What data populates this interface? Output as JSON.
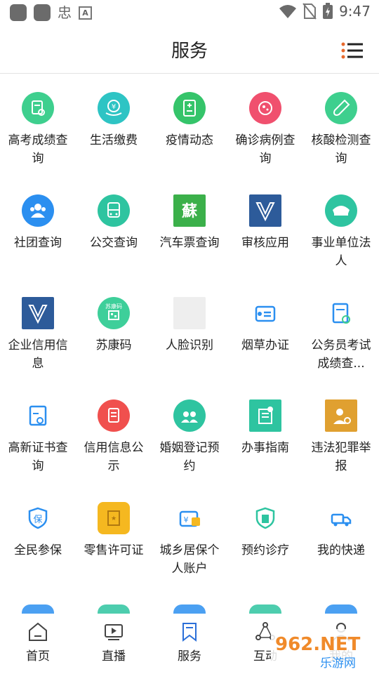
{
  "status_bar": {
    "time": "9:47",
    "glyph": "忠",
    "a_label": "A"
  },
  "header": {
    "title": "服务"
  },
  "services": [
    {
      "label": "高考成绩查询",
      "icon": "exam-score-icon",
      "color": "#3ecf8e"
    },
    {
      "label": "生活缴费",
      "icon": "payment-icon",
      "color": "#2ec4c4"
    },
    {
      "label": "疫情动态",
      "icon": "epidemic-icon",
      "color": "#35c46a"
    },
    {
      "label": "确诊病例查询",
      "icon": "virus-icon",
      "color": "#f0506e"
    },
    {
      "label": "核酸检测查询",
      "icon": "test-tube-icon",
      "color": "#3ecf8e"
    },
    {
      "label": "社团查询",
      "icon": "group-icon",
      "color": "#2b8ff0"
    },
    {
      "label": "公交查询",
      "icon": "bus-icon",
      "color": "#2ec4a0"
    },
    {
      "label": "汽车票查询",
      "icon": "su-calligraphy-icon",
      "color": "#3bb04a"
    },
    {
      "label": "审核应用",
      "icon": "v-logo-icon",
      "color": "#2d5b9a"
    },
    {
      "label": "事业单位法人",
      "icon": "official-cap-icon",
      "color": "#2ec4a0"
    },
    {
      "label": "企业信用信息",
      "icon": "v-logo-icon",
      "color": "#2d5b9a"
    },
    {
      "label": "苏康码",
      "icon": "health-code-icon",
      "color": "#3ecf9a"
    },
    {
      "label": "人脸识别",
      "icon": "face-placeholder-icon",
      "color": "#eeeeee"
    },
    {
      "label": "烟草办证",
      "icon": "id-card-icon",
      "color": "#2b8ff0"
    },
    {
      "label": "公务员考试成绩查...",
      "icon": "clipboard-search-icon",
      "color": "#2b8ff0"
    },
    {
      "label": "高新证书查询",
      "icon": "certificate-icon",
      "color": "#2b8ff0"
    },
    {
      "label": "信用信息公示",
      "icon": "document-icon",
      "color": "#f0504e"
    },
    {
      "label": "婚姻登记预约",
      "icon": "couple-icon",
      "color": "#2ec4a0"
    },
    {
      "label": "办事指南",
      "icon": "guide-icon",
      "color": "#2ec4a0"
    },
    {
      "label": "违法犯罪举报",
      "icon": "police-icon",
      "color": "#e0a030"
    },
    {
      "label": "全民参保",
      "icon": "insurance-shield-icon",
      "color": "#2b8ff0"
    },
    {
      "label": "零售许可证",
      "icon": "license-icon",
      "color": "#f5b820"
    },
    {
      "label": "城乡居保个人账户",
      "icon": "wallet-icon",
      "color": "#2b8ff0"
    },
    {
      "label": "预约诊疗",
      "icon": "hospital-shield-icon",
      "color": "#2ec4a0"
    },
    {
      "label": "我的快递",
      "icon": "delivery-truck-icon",
      "color": "#2b8ff0"
    }
  ],
  "partial_row_icons": [
    "#2b8ff0",
    "#2ec4a0",
    "#2b8ff0",
    "#2ec4a0",
    "#2b8ff0"
  ],
  "tabs": [
    {
      "label": "首页",
      "icon": "home-icon"
    },
    {
      "label": "直播",
      "icon": "play-icon"
    },
    {
      "label": "服务",
      "icon": "bookmark-icon"
    },
    {
      "label": "互动",
      "icon": "interact-icon"
    },
    {
      "label": "我的",
      "icon": "user-icon"
    }
  ],
  "watermark": {
    "text1": "962.NET",
    "text2": "乐游网"
  }
}
